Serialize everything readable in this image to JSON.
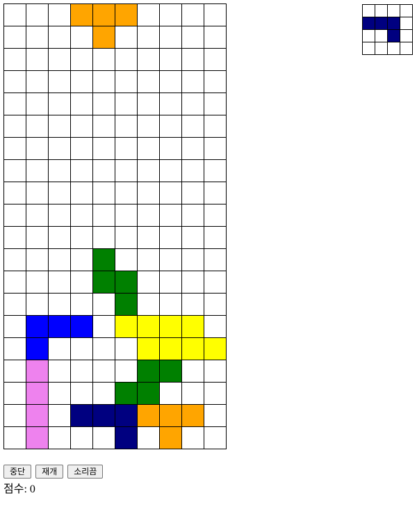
{
  "colors": {
    ".": "#ffffff",
    "O": "#ffa500",
    "G": "#008000",
    "B": "#0000ff",
    "Y": "#ffff00",
    "P": "#ee82ee",
    "N": "#000080"
  },
  "board": {
    "rows": [
      "...OOO....",
      "....O.....",
      "..........",
      "..........",
      "..........",
      "..........",
      "..........",
      "..........",
      "..........",
      "..........",
      "..........",
      "....G.....",
      "....GG....",
      ".....G....",
      ".BBB.YYYY.",
      ".B....YYYY",
      ".P....GG..",
      ".P...GG...",
      ".P.NNNOOO.",
      ".P...N.O.."
    ]
  },
  "next_piece": {
    "rows": [
      "....",
      "NNN.",
      "..N.",
      "...."
    ]
  },
  "controls": {
    "stop_label": "중단",
    "resume_label": "재개",
    "sound_off_label": "소리끔"
  },
  "score": {
    "label": "점수:",
    "value": "0"
  }
}
